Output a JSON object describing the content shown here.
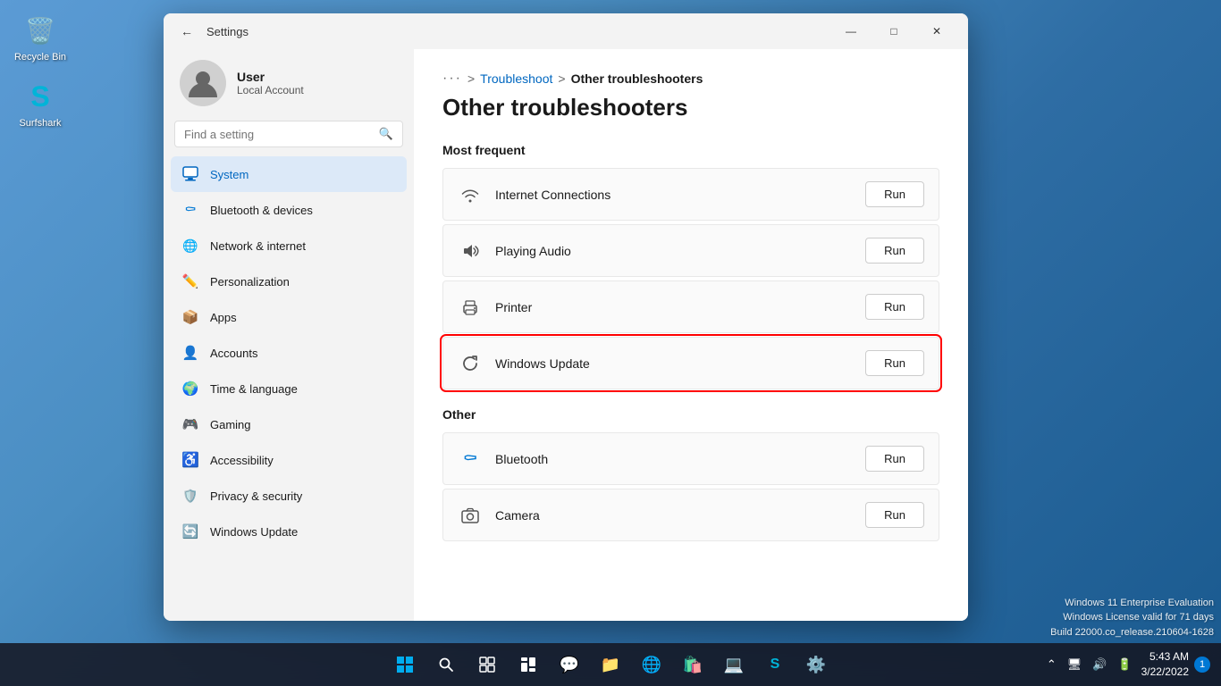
{
  "desktop": {
    "icons": [
      {
        "id": "recycle-bin",
        "label": "Recycle Bin",
        "symbol": "🗑"
      },
      {
        "id": "surfshark",
        "label": "Surfshark",
        "symbol": "🦈"
      }
    ]
  },
  "taskbar": {
    "items": [
      {
        "id": "start",
        "symbol": "⊞",
        "label": "Start"
      },
      {
        "id": "search",
        "symbol": "🔍",
        "label": "Search"
      },
      {
        "id": "task-view",
        "symbol": "❐",
        "label": "Task View"
      },
      {
        "id": "widgets",
        "symbol": "▦",
        "label": "Widgets"
      },
      {
        "id": "chat",
        "symbol": "💬",
        "label": "Chat"
      },
      {
        "id": "file-explorer",
        "symbol": "📁",
        "label": "File Explorer"
      },
      {
        "id": "edge",
        "symbol": "🌐",
        "label": "Microsoft Edge"
      },
      {
        "id": "store",
        "symbol": "🛍",
        "label": "Microsoft Store"
      },
      {
        "id": "vs",
        "symbol": "💻",
        "label": "Visual Studio"
      },
      {
        "id": "surfshark-tb",
        "symbol": "S",
        "label": "Surfshark"
      },
      {
        "id": "settings-tb",
        "symbol": "⚙",
        "label": "Settings"
      }
    ],
    "clock": {
      "time": "5:43 AM",
      "date": "3/22/2022"
    },
    "notification_count": "1"
  },
  "window": {
    "title": "Settings",
    "controls": {
      "minimize": "—",
      "maximize": "□",
      "close": "✕"
    }
  },
  "sidebar": {
    "user": {
      "name": "User",
      "account_type": "Local Account"
    },
    "search_placeholder": "Find a setting",
    "nav_items": [
      {
        "id": "system",
        "label": "System",
        "icon_type": "system",
        "active": true
      },
      {
        "id": "bluetooth",
        "label": "Bluetooth & devices",
        "icon_type": "bluetooth"
      },
      {
        "id": "network",
        "label": "Network & internet",
        "icon_type": "network"
      },
      {
        "id": "personalization",
        "label": "Personalization",
        "icon_type": "pencil"
      },
      {
        "id": "apps",
        "label": "Apps",
        "icon_type": "apps"
      },
      {
        "id": "accounts",
        "label": "Accounts",
        "icon_type": "accounts"
      },
      {
        "id": "time",
        "label": "Time & language",
        "icon_type": "time"
      },
      {
        "id": "gaming",
        "label": "Gaming",
        "icon_type": "gaming"
      },
      {
        "id": "accessibility",
        "label": "Accessibility",
        "icon_type": "accessibility"
      },
      {
        "id": "privacy",
        "label": "Privacy & security",
        "icon_type": "privacy"
      },
      {
        "id": "windows-update",
        "label": "Windows Update",
        "icon_type": "update"
      }
    ]
  },
  "main": {
    "breadcrumb": {
      "dots": "···",
      "arrow1": ">",
      "link": "Troubleshoot",
      "arrow2": ">",
      "current": "Other troubleshooters"
    },
    "page_title": "Other troubleshooters",
    "sections": [
      {
        "id": "most-frequent",
        "title": "Most frequent",
        "items": [
          {
            "id": "internet-connections",
            "label": "Internet Connections",
            "icon": "wifi",
            "highlighted": false
          },
          {
            "id": "playing-audio",
            "label": "Playing Audio",
            "icon": "audio",
            "highlighted": false
          },
          {
            "id": "printer",
            "label": "Printer",
            "icon": "printer",
            "highlighted": false
          },
          {
            "id": "windows-update",
            "label": "Windows Update",
            "icon": "update",
            "highlighted": true
          }
        ]
      },
      {
        "id": "other",
        "title": "Other",
        "items": [
          {
            "id": "bluetooth",
            "label": "Bluetooth",
            "icon": "bluetooth",
            "highlighted": false
          },
          {
            "id": "camera",
            "label": "Camera",
            "icon": "camera",
            "highlighted": false
          }
        ]
      }
    ],
    "run_button_label": "Run"
  },
  "watermark": {
    "line1": "Windows 11 Enterprise Evaluation",
    "line2": "Windows License valid for 71 days",
    "line3": "Build 22000.co_release.210604-1628"
  }
}
